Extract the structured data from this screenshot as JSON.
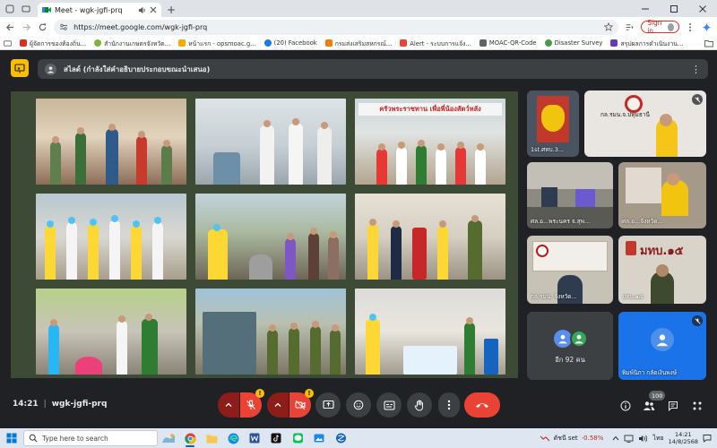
{
  "browser": {
    "tab_title": "Meet - wgk-jgfi-prq",
    "new_tab": "+",
    "url": "https://meet.google.com/wgk-jgfi-prq",
    "sign_in": "Sign in",
    "bookmarks": [
      {
        "label": "ผู้จัดการของท้องถิ่น...",
        "color": "#d93025"
      },
      {
        "label": "สำนักงานเกษตรจังหวัด...",
        "color": "#7cb342"
      },
      {
        "label": "หน้าแรก - opsmoac.g...",
        "color": "#f9ab00"
      },
      {
        "label": "(20) Facebook",
        "color": "#1877f2"
      },
      {
        "label": "กรมส่งเสริมสหกรณ์...",
        "color": "#f57c00"
      },
      {
        "label": "Alert - ระบบการแจ้ง...",
        "color": "#ea4335"
      },
      {
        "label": "MOAC-QR-Code",
        "color": "#5f6368"
      },
      {
        "label": "Disaster Survey",
        "color": "#43a047"
      },
      {
        "label": "สรุปผลการดำเนินงาน...",
        "color": "#673ab7"
      }
    ]
  },
  "meet": {
    "presentation_title": "สไลด์ (กำลังใส่คำอธิบายประกอบขณะนำเสนอ)",
    "slide_banner": "ครัวพระราชทาน เพื่อพี่น้องสัตว์หลัง",
    "time": "14:21",
    "meeting_code": "wgk-jgfi-prq",
    "participant_count": "100",
    "participants": [
      {
        "name": "1st.ศทบ.3...",
        "muted": false,
        "bg": "#4a5360"
      },
      {
        "name": "กล.รมน.จ.ปทุมธานี",
        "muted": true,
        "bg": "#e9e6e1"
      },
      {
        "name": "ศล.อ...พระนคร จ.สุพ...",
        "muted": false,
        "bg": "#8d8a82"
      },
      {
        "name": "ศล.อ...จังหวัด...",
        "muted": false,
        "bg": "#a59a8a"
      },
      {
        "name": "กล.รมน. จังหวัด...",
        "muted": false,
        "bg": "#c7c2b6"
      },
      {
        "name": "มทบ.๑๕",
        "muted": false,
        "bg": "#d9d4c9"
      },
      {
        "name": "อีก 92 คน",
        "muted": false,
        "bg": "#3c4043"
      },
      {
        "name": "พิมพ์นิภา กลัดเงินพงษ์",
        "muted": true,
        "bg": "#1a73e8"
      }
    ],
    "tile_logo_text": "มทบ.๑๕",
    "more_initials": [
      "",
      ""
    ]
  },
  "taskbar": {
    "search_placeholder": "Type here to search",
    "stock_label": "ดัชนี set",
    "stock_change": "-0.58%",
    "language": "ไทย",
    "clock_time": "14:21",
    "clock_date": "14/8/2568"
  },
  "colors": {
    "meet_bg": "#202124",
    "slide_bg": "#3d4a36",
    "danger": "#ea4335",
    "accent": "#fbbc04"
  }
}
